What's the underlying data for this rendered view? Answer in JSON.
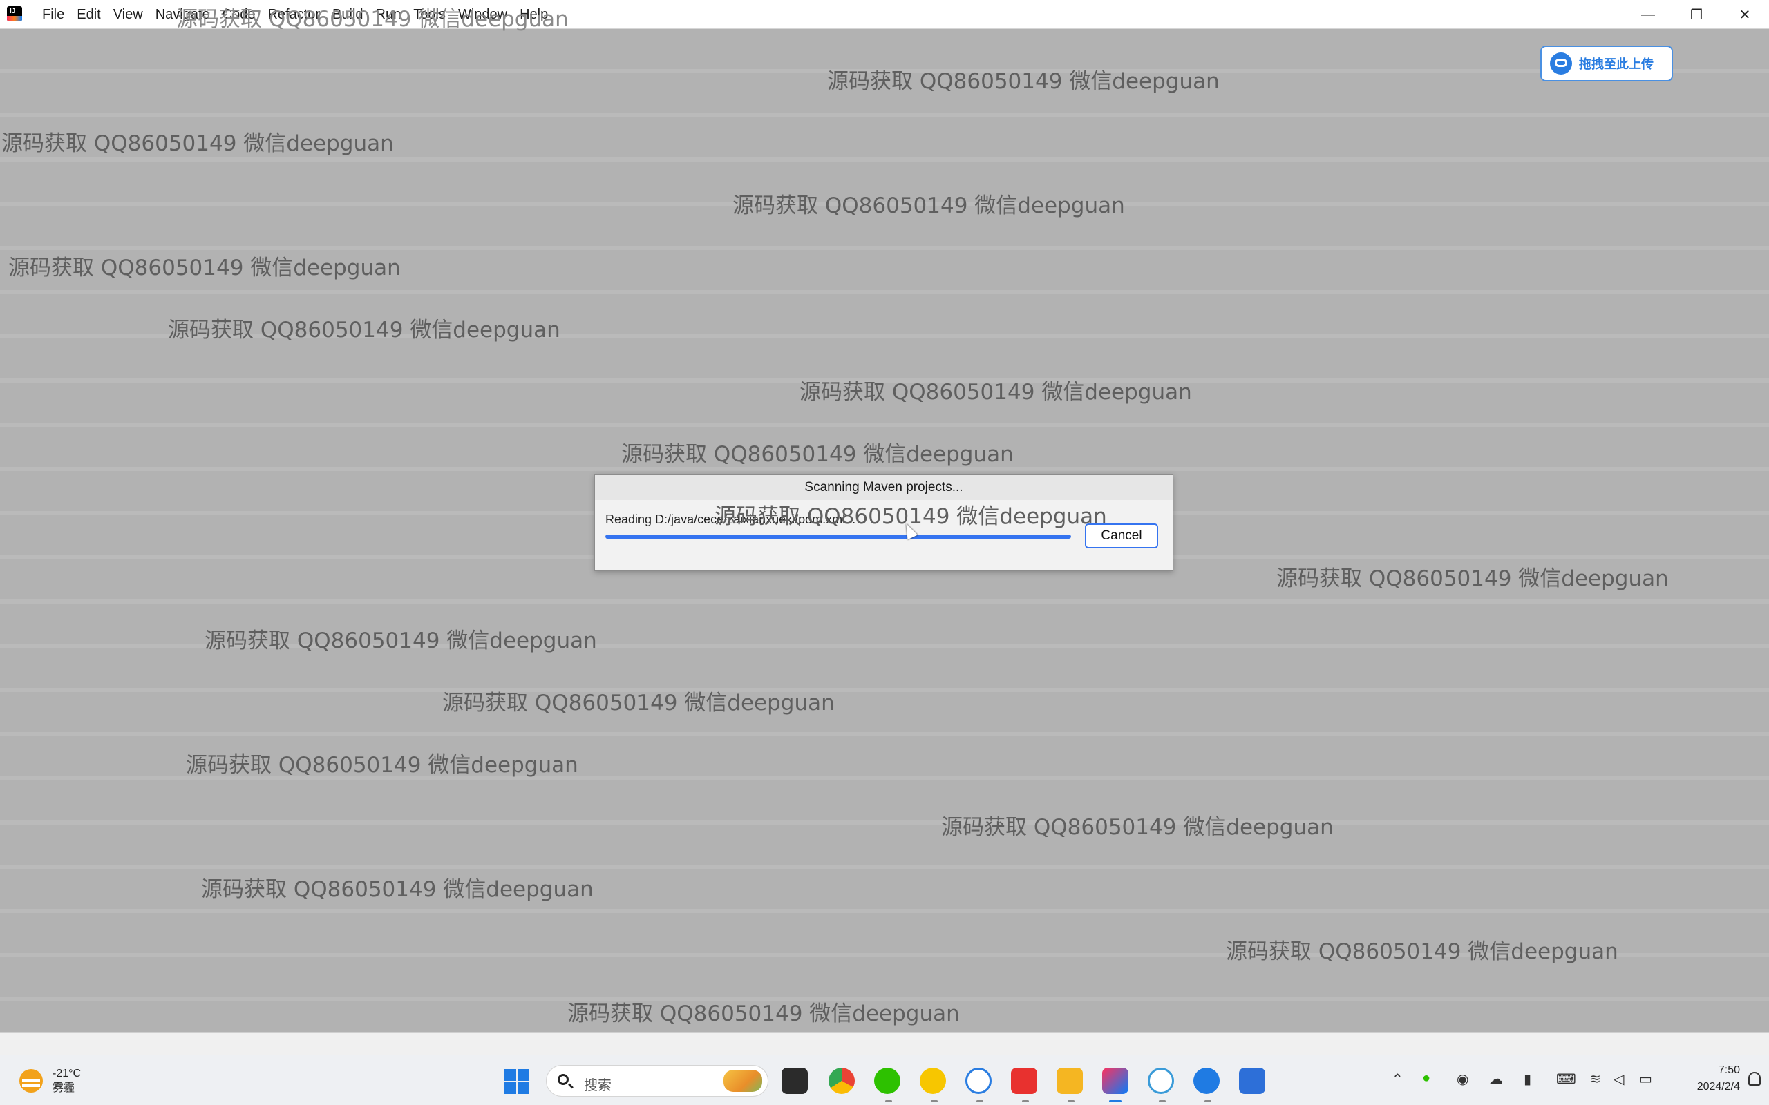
{
  "window": {
    "menu": [
      "File",
      "Edit",
      "View",
      "Navigate",
      "Code",
      "Refactor",
      "Build",
      "Run",
      "Tools",
      "Window",
      "Help"
    ],
    "controls": {
      "minimize": "—",
      "restore": "❐",
      "close": "✕"
    }
  },
  "watermark": {
    "text": "源码获取 QQ86050149 微信deepguan"
  },
  "upload_widget": {
    "label": "拖拽至此上传"
  },
  "dialog": {
    "title": "Scanning Maven projects...",
    "status": "Reading D:/java/cece/zaixianxuexi/pom.xml...",
    "progress": 1.0,
    "cancel_label": "Cancel"
  },
  "taskbar": {
    "weather_temp": "-21°C",
    "weather_desc": "雾霾",
    "search_placeholder": "搜索",
    "clock_time": "7:50",
    "clock_date": "2024/2/4",
    "apps": [
      "task-view-icon",
      "chrome-icon",
      "wechat-icon",
      "qq-music-icon",
      "baidu-netdisk-icon",
      "wps-icon",
      "file-explorer-icon",
      "intellij-icon",
      "browser-icon",
      "feishu-icon",
      "notepad-icon"
    ],
    "tray": [
      "chevron-up-icon",
      "wechat-tray-icon",
      "qq-tray-icon",
      "cloud-icon",
      "mic-icon",
      "ime-icon",
      "wifi-icon",
      "volume-icon",
      "battery-icon"
    ]
  },
  "colors": {
    "accent": "#3574f0",
    "workspace": "#b2b2b2",
    "watermark": "#5f5f5f"
  }
}
